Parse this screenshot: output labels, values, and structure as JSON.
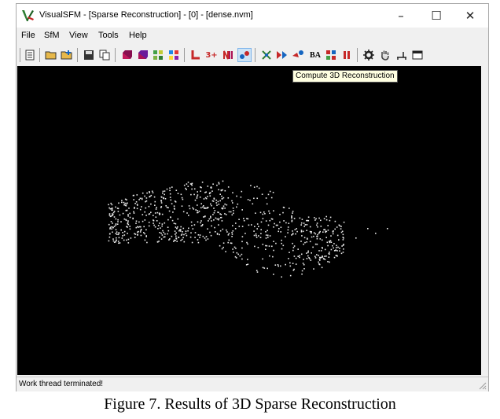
{
  "window": {
    "title": "VisualSFM - [Sparse Reconstruction] - [0] - [dense.nvm]",
    "minimize_glyph": "–",
    "maximize_glyph": "☐",
    "close_glyph": "✕"
  },
  "menu": [
    "File",
    "SfM",
    "View",
    "Tools",
    "Help"
  ],
  "toolbar": {
    "tooltip": "Compute 3D Reconstruction",
    "button_labels": {
      "three_plus": "3+",
      "ba": "BA"
    },
    "icons": [
      "notepad-icon",
      "open-folder-icon",
      "open-folder-add-icon",
      "save-icon",
      "copy-icon",
      "cube-red-icon",
      "cube-magenta-icon",
      "grid-green-icon",
      "grid-color-icon",
      "match-icon",
      "three-plus-icon",
      "nm-icon",
      "pair-icon",
      "sparse-points-icon",
      "compute-3d-icon",
      "dense-icon",
      "ba-icon",
      "cmvs-icon",
      "pause-icon",
      "gear-icon",
      "hand-icon",
      "desk-icon",
      "window-icon"
    ]
  },
  "status": {
    "text": "Work thread terminated!"
  },
  "caption": "Figure 7. Results of 3D Sparse Reconstruction",
  "colors": {
    "viewport_bg": "#000000",
    "points": "#e8e8e8",
    "tooltip_bg": "#ffffe1"
  }
}
